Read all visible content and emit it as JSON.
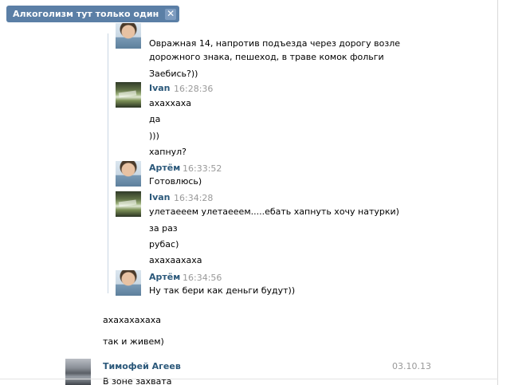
{
  "filter": {
    "label": "Алкоголизм тут только один",
    "close": "✕"
  },
  "quoted": {
    "messages": [
      {
        "lines": [
          "Овражная 14, напротив подъезда через дорогу возле",
          "дорожного знака, пешеход, в траве комок фольги"
        ]
      },
      {
        "lines": [
          "Заебись?))"
        ]
      },
      {
        "author": "Ivan",
        "time": "16:28:36",
        "avatar": "ivan-avatar"
      },
      {
        "lines": [
          "ахаххаха"
        ]
      },
      {
        "lines": [
          "да"
        ]
      },
      {
        "lines": [
          ")))"
        ]
      },
      {
        "lines": [
          "хапнул?"
        ]
      },
      {
        "author": "Артём",
        "time": "16:33:52",
        "avatar": "artem-avatar"
      },
      {
        "lines": [
          "Готовлюсь)"
        ]
      },
      {
        "author": "Ivan",
        "time": "16:34:28",
        "avatar": "ivan-avatar"
      },
      {
        "lines": [
          "улетаееем улетаееем.....ебать хапнуть хочу натурки)"
        ]
      },
      {
        "lines": [
          "за раз"
        ]
      },
      {
        "lines": [
          "рубас)"
        ]
      },
      {
        "lines": [
          "ахахаахаха"
        ]
      },
      {
        "author": "Артём",
        "time": "16:34:56",
        "avatar": "artem-avatar"
      },
      {
        "lines": [
          "Ну так бери как деньги будут))"
        ]
      }
    ]
  },
  "own": {
    "messages": [
      "ахахахахаха",
      "так и живем)"
    ]
  },
  "next": {
    "author": "Тимофей Агеев",
    "date": "03.10.13",
    "preview": "В зоне захвата"
  },
  "colors": {
    "link": "#2b587a",
    "tag": "#5b7fa6",
    "quote_line": "#c9d6e3"
  }
}
